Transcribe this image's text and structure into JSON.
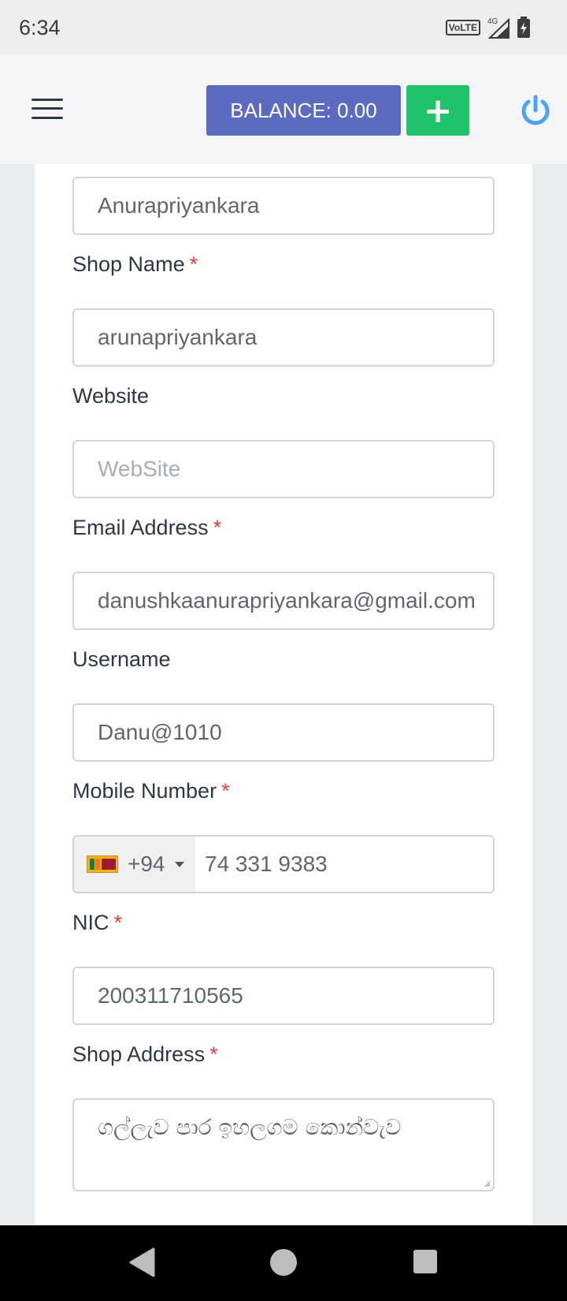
{
  "status_bar": {
    "time": "6:34",
    "volte": "VoLTE",
    "network": "4G"
  },
  "header": {
    "balance_label": "BALANCE: 0.00",
    "add_label": "+"
  },
  "form": {
    "name_value": "Anurapriyankara",
    "shop_name": {
      "label": "Shop Name",
      "required": "*",
      "value": "arunapriyankara"
    },
    "website": {
      "label": "Website",
      "placeholder": "WebSite"
    },
    "email": {
      "label": "Email Address",
      "required": "*",
      "value": "danushkaanurapriyankara@gmail.com"
    },
    "username": {
      "label": "Username",
      "value": "Danu@1010"
    },
    "mobile": {
      "label": "Mobile Number",
      "required": "*",
      "country_code": "+94",
      "value": "74 331 9383"
    },
    "nic": {
      "label": "NIC",
      "required": "*",
      "value": "200311710565"
    },
    "shop_address": {
      "label": "Shop Address",
      "required": "*",
      "value": "ගල්ලැව පාර ඉහලගම කොන්වැව"
    }
  }
}
